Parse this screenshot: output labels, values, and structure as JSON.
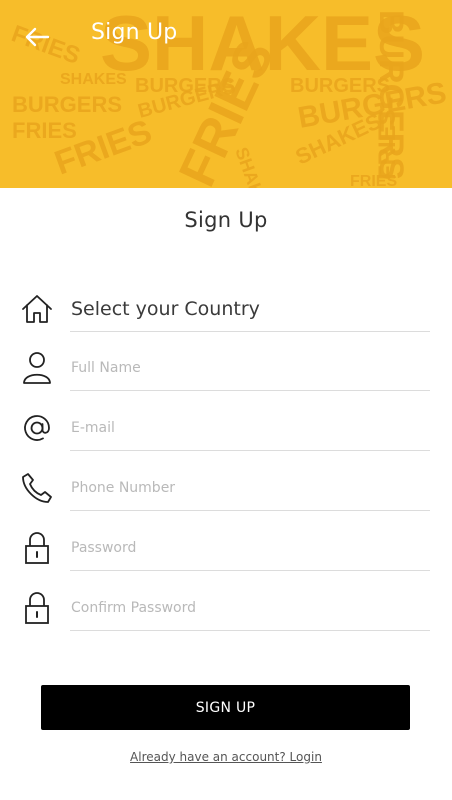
{
  "header": {
    "title": "Sign Up",
    "back_icon": "arrow-left-icon",
    "banner_words": [
      "SHAKES",
      "BURGERS",
      "FRIES"
    ],
    "banner_color": "#f7bd2a"
  },
  "form": {
    "title": "Sign Up",
    "country": {
      "label": "Select your Country",
      "icon": "home-icon"
    },
    "full_name": {
      "placeholder": "Full Name",
      "icon": "user-icon"
    },
    "email": {
      "placeholder": "E-mail",
      "icon": "at-icon"
    },
    "phone": {
      "placeholder": "Phone Number",
      "icon": "phone-icon"
    },
    "password": {
      "placeholder": "Password",
      "icon": "lock-icon"
    },
    "confirm_password": {
      "placeholder": "Confirm Password",
      "icon": "lock-icon"
    }
  },
  "actions": {
    "signup_label": "SIGN UP",
    "login_link": "Already have an account? Login"
  }
}
